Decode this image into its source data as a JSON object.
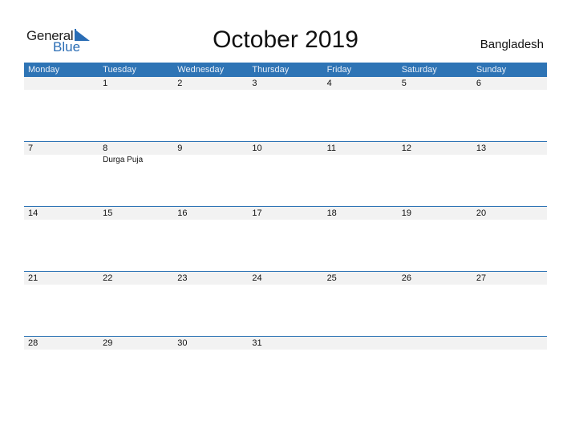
{
  "logo": {
    "general": "General",
    "blue": "Blue"
  },
  "title": "October 2019",
  "country": "Bangladesh",
  "weekdays": [
    "Monday",
    "Tuesday",
    "Wednesday",
    "Thursday",
    "Friday",
    "Saturday",
    "Sunday"
  ],
  "weeks": [
    {
      "days": [
        "",
        "1",
        "2",
        "3",
        "4",
        "5",
        "6"
      ],
      "events": [
        "",
        "",
        "",
        "",
        "",
        "",
        ""
      ]
    },
    {
      "days": [
        "7",
        "8",
        "9",
        "10",
        "11",
        "12",
        "13"
      ],
      "events": [
        "",
        "Durga Puja",
        "",
        "",
        "",
        "",
        ""
      ]
    },
    {
      "days": [
        "14",
        "15",
        "16",
        "17",
        "18",
        "19",
        "20"
      ],
      "events": [
        "",
        "",
        "",
        "",
        "",
        "",
        ""
      ]
    },
    {
      "days": [
        "21",
        "22",
        "23",
        "24",
        "25",
        "26",
        "27"
      ],
      "events": [
        "",
        "",
        "",
        "",
        "",
        "",
        ""
      ]
    },
    {
      "days": [
        "28",
        "29",
        "30",
        "31",
        "",
        "",
        ""
      ],
      "events": [
        "",
        "",
        "",
        "",
        "",
        "",
        ""
      ]
    }
  ],
  "colors": {
    "accent": "#2e74b5",
    "strip": "#f2f2f2"
  }
}
